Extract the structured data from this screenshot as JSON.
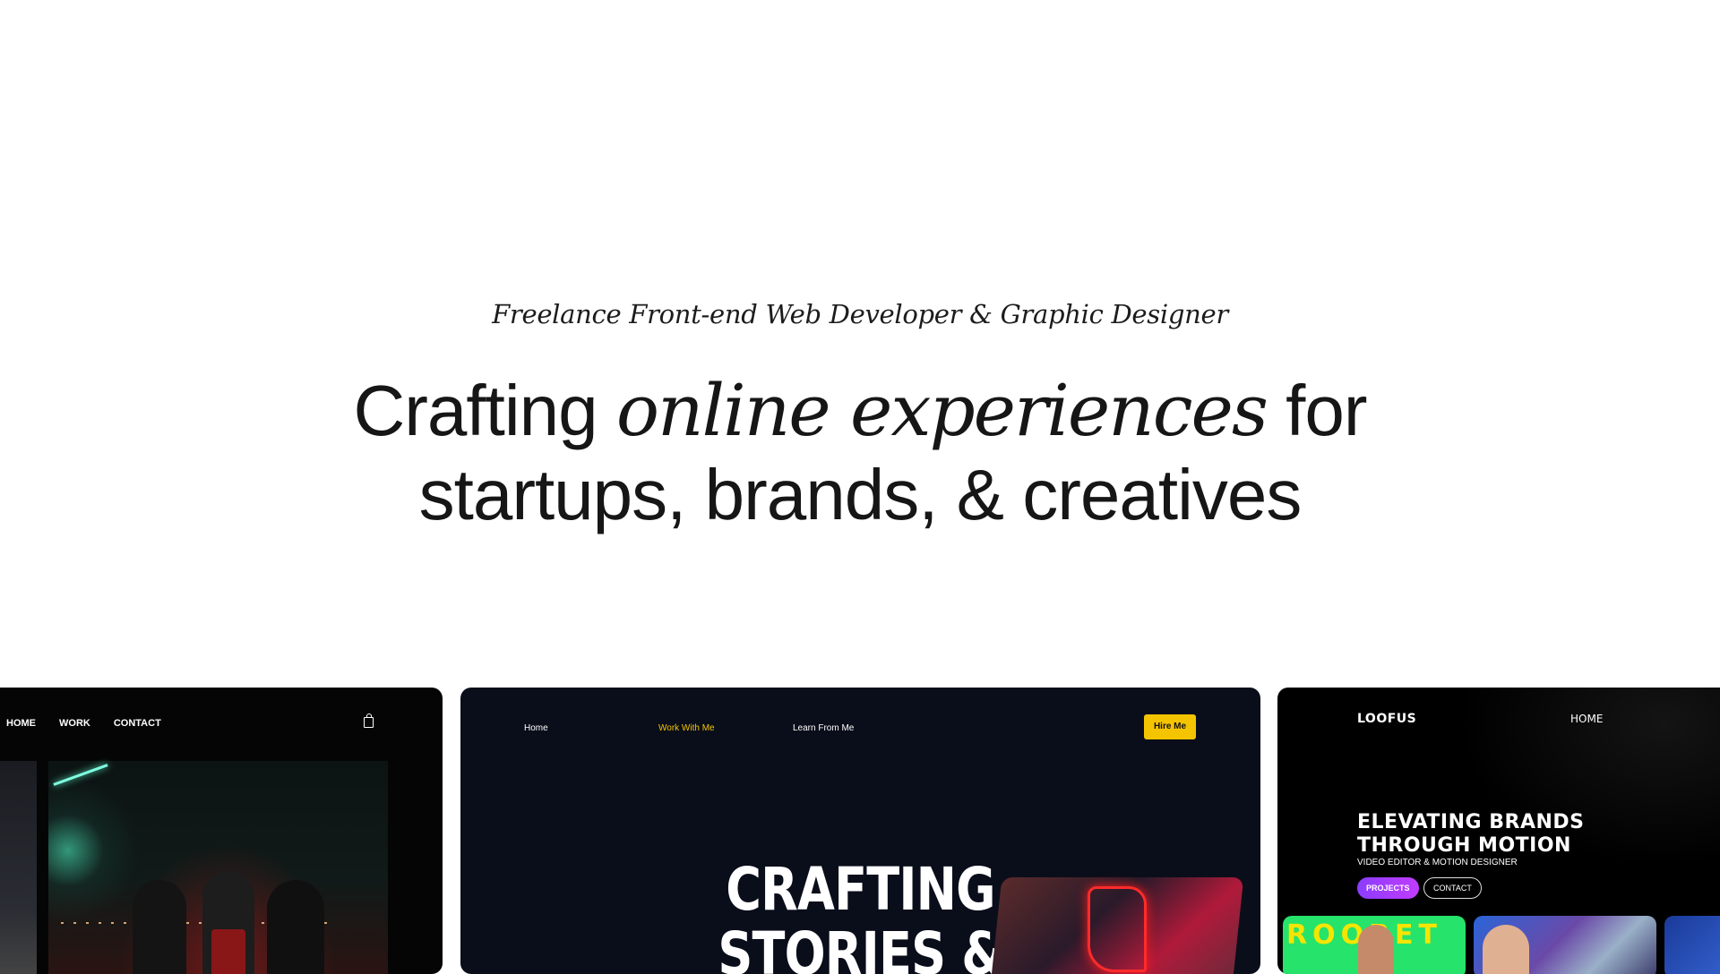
{
  "hero": {
    "tagline": "Freelance Front-end Web Developer & Graphic Designer",
    "headline_part1": "Crafting ",
    "headline_italic": "online experiences",
    "headline_part2": " for",
    "headline_line2": "startups, brands, & creatives"
  },
  "card_a": {
    "nav": [
      "HOME",
      "WORK",
      "CONTACT"
    ],
    "cart_icon": "shopping-bag-icon"
  },
  "card_b": {
    "nav": {
      "home": "Home",
      "work": "Work With Me",
      "learn": "Learn From Me"
    },
    "hire_button": "Hire Me",
    "title_line1": "CRAFTING",
    "title_line2": "STORIES &",
    "accent": "#f5c400"
  },
  "card_c": {
    "logo": "LOOFUS",
    "nav_home": "HOME",
    "title_line1": "ELEVATING BRANDS",
    "title_line2": "THROUGH MOTION",
    "subtitle": "VIDEO EDITOR & MOTION DESIGNER",
    "projects_button": "PROJECTS",
    "contact_button": "CONTACT",
    "tile_text": "ROOBET"
  }
}
